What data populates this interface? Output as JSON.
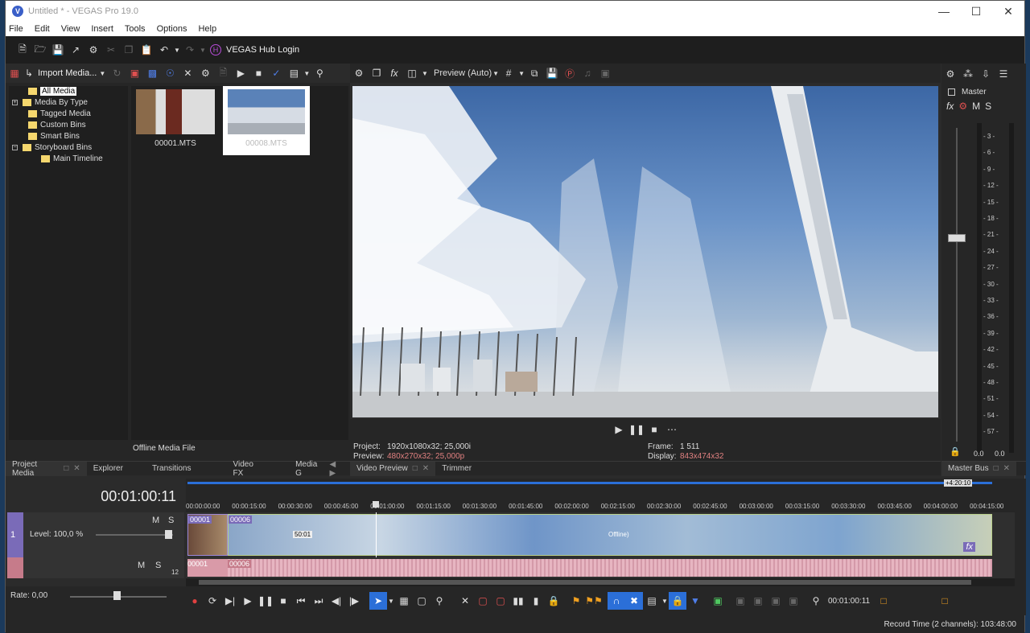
{
  "window": {
    "title": "Untitled * - VEGAS Pro 19.0",
    "app_icon": "V"
  },
  "menu": [
    "File",
    "Edit",
    "View",
    "Insert",
    "Tools",
    "Options",
    "Help"
  ],
  "toolbar": {
    "hub_label": "VEGAS Hub Login",
    "hub_icon": "H"
  },
  "project_media": {
    "import_label": "Import Media...",
    "tree": [
      {
        "label": "All Media"
      },
      {
        "label": "Media By Type"
      },
      {
        "label": "Tagged Media"
      },
      {
        "label": "Custom Bins"
      },
      {
        "label": "Smart Bins"
      },
      {
        "label": "Storyboard Bins"
      },
      {
        "label": "Main Timeline"
      }
    ],
    "files": [
      {
        "name": "00001.MTS"
      },
      {
        "name": "00008.MTS"
      }
    ],
    "status": "Offline Media File",
    "tabs": [
      "Project Media",
      "Explorer",
      "Transitions",
      "Video FX",
      "Media G"
    ]
  },
  "video_preview": {
    "mode": "Preview (Auto)",
    "project_label": "Project:",
    "project_value": "1920x1080x32; 25,000i",
    "preview_label": "Preview:",
    "preview_value": "480x270x32; 25,000p",
    "frame_label": "Frame:",
    "frame_value": "1 511",
    "display_label": "Display:",
    "display_value": "843x474x32",
    "tabs": [
      "Video Preview",
      "Trimmer"
    ]
  },
  "master_bus": {
    "label": "Master",
    "fx": "fx",
    "m": "M",
    "s": "S",
    "scale": [
      "3",
      "6",
      "9",
      "12",
      "15",
      "18",
      "21",
      "24",
      "27",
      "30",
      "33",
      "36",
      "39",
      "42",
      "45",
      "48",
      "51",
      "54",
      "57"
    ],
    "left_value": "0.0",
    "right_value": "0.0",
    "tab": "Master Bus"
  },
  "timeline": {
    "time": "00:01:00:11",
    "duration_badge": "+4:20:10",
    "ruler": [
      "00:00:00:00",
      "00:00:15:00",
      "00:00:30:00",
      "00:00:45:00",
      "00:01:00:00",
      "00:01:15:00",
      "00:01:30:00",
      "00:01:45:00",
      "00:02:00:00",
      "00:02:15:00",
      "00:02:30:00",
      "00:02:45:00",
      "00:03:00:00",
      "00:03:15:00",
      "00:03:30:00",
      "00:03:45:00",
      "00:04:00:00",
      "00:04:15:00"
    ],
    "video_track": {
      "num": "1",
      "m": "M",
      "s": "S",
      "level": "Level: 100,0 %",
      "clip_a": "00001",
      "clip_b": "00006",
      "fade": "50:01",
      "offline": "Offline)",
      "fx": "fx"
    },
    "audio_track": {
      "m": "M",
      "s": "S",
      "clip_a": "00001",
      "clip_b": "00006",
      "num": "12"
    },
    "rate": "Rate: 0,00",
    "bottom_time": "00:01:00:11"
  },
  "status": {
    "record_time": "Record Time (2 channels): 103:48:00"
  }
}
